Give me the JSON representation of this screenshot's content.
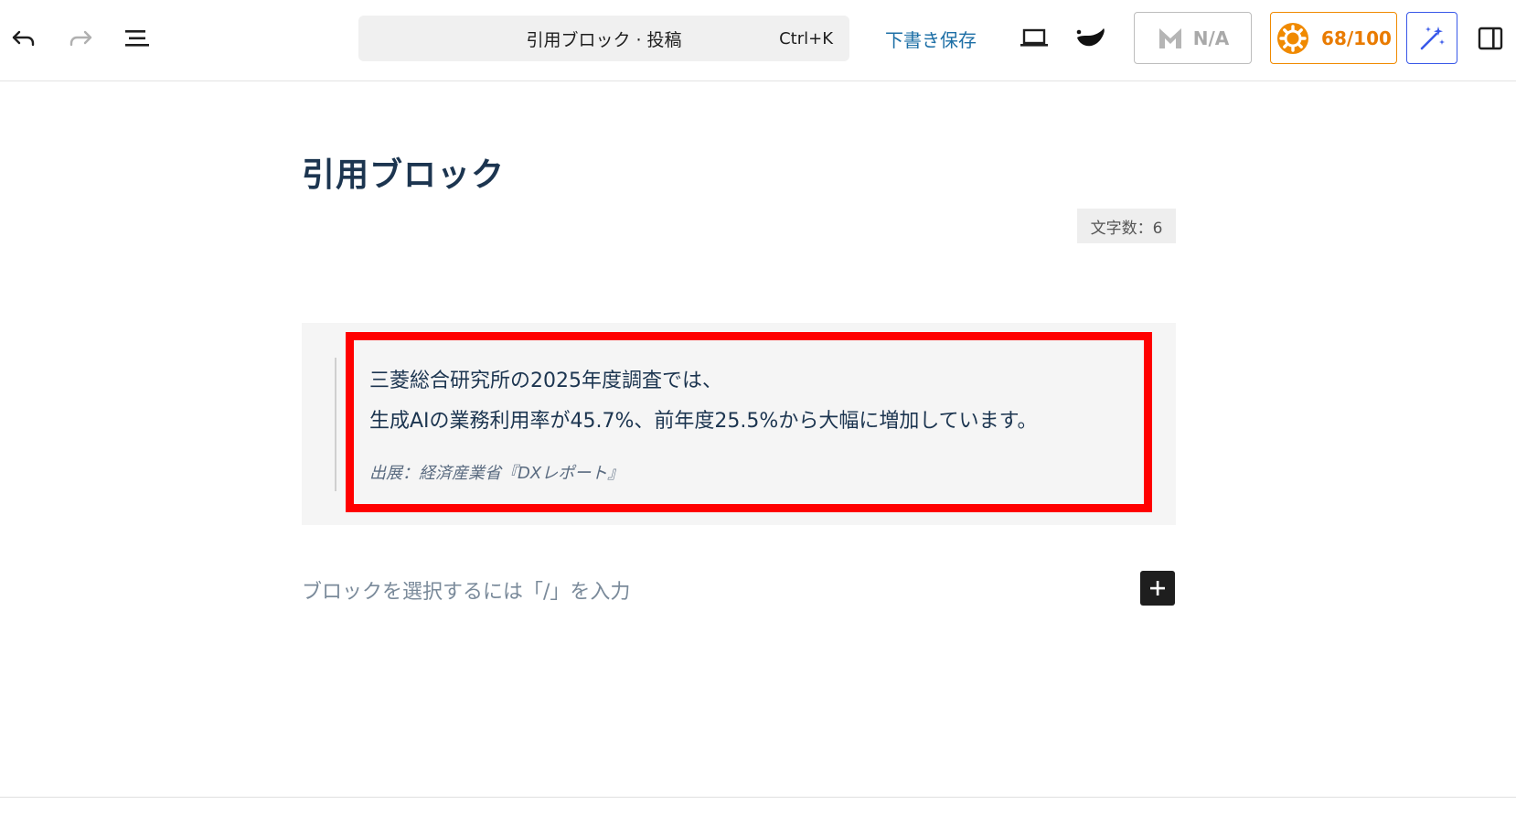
{
  "toolbar": {
    "command_title": "引用ブロック · 投稿",
    "command_shortcut": "Ctrl+K",
    "save_draft": "下書き保存",
    "seo_na": "N/A",
    "seo_score": "68/100",
    "icons": {
      "undo": "undo-icon",
      "redo": "redo-icon",
      "list_view": "list-view-icon",
      "preview": "laptop-icon",
      "theme": "leaf-icon",
      "seo": "m-logo-icon",
      "score": "gear-badge-icon",
      "ai": "magic-wand-icon",
      "sidebar": "sidebar-toggle-icon"
    },
    "colors": {
      "link": "#1d6fa6",
      "score": "#e97b00",
      "ai_border": "#3858e9"
    }
  },
  "editor": {
    "title": "引用ブロック",
    "char_count": "文字数：6",
    "quote": {
      "line1": "三菱総合研究所の2025年度調査では、",
      "line2": "生成AIの業務利用率が45.7%、前年度25.5%から大幅に増加しています。",
      "citation": "出展：経済産業省『DXレポート』",
      "highlight_color": "#ff0000"
    },
    "placeholder": "ブロックを選択するには「/」を入力"
  }
}
